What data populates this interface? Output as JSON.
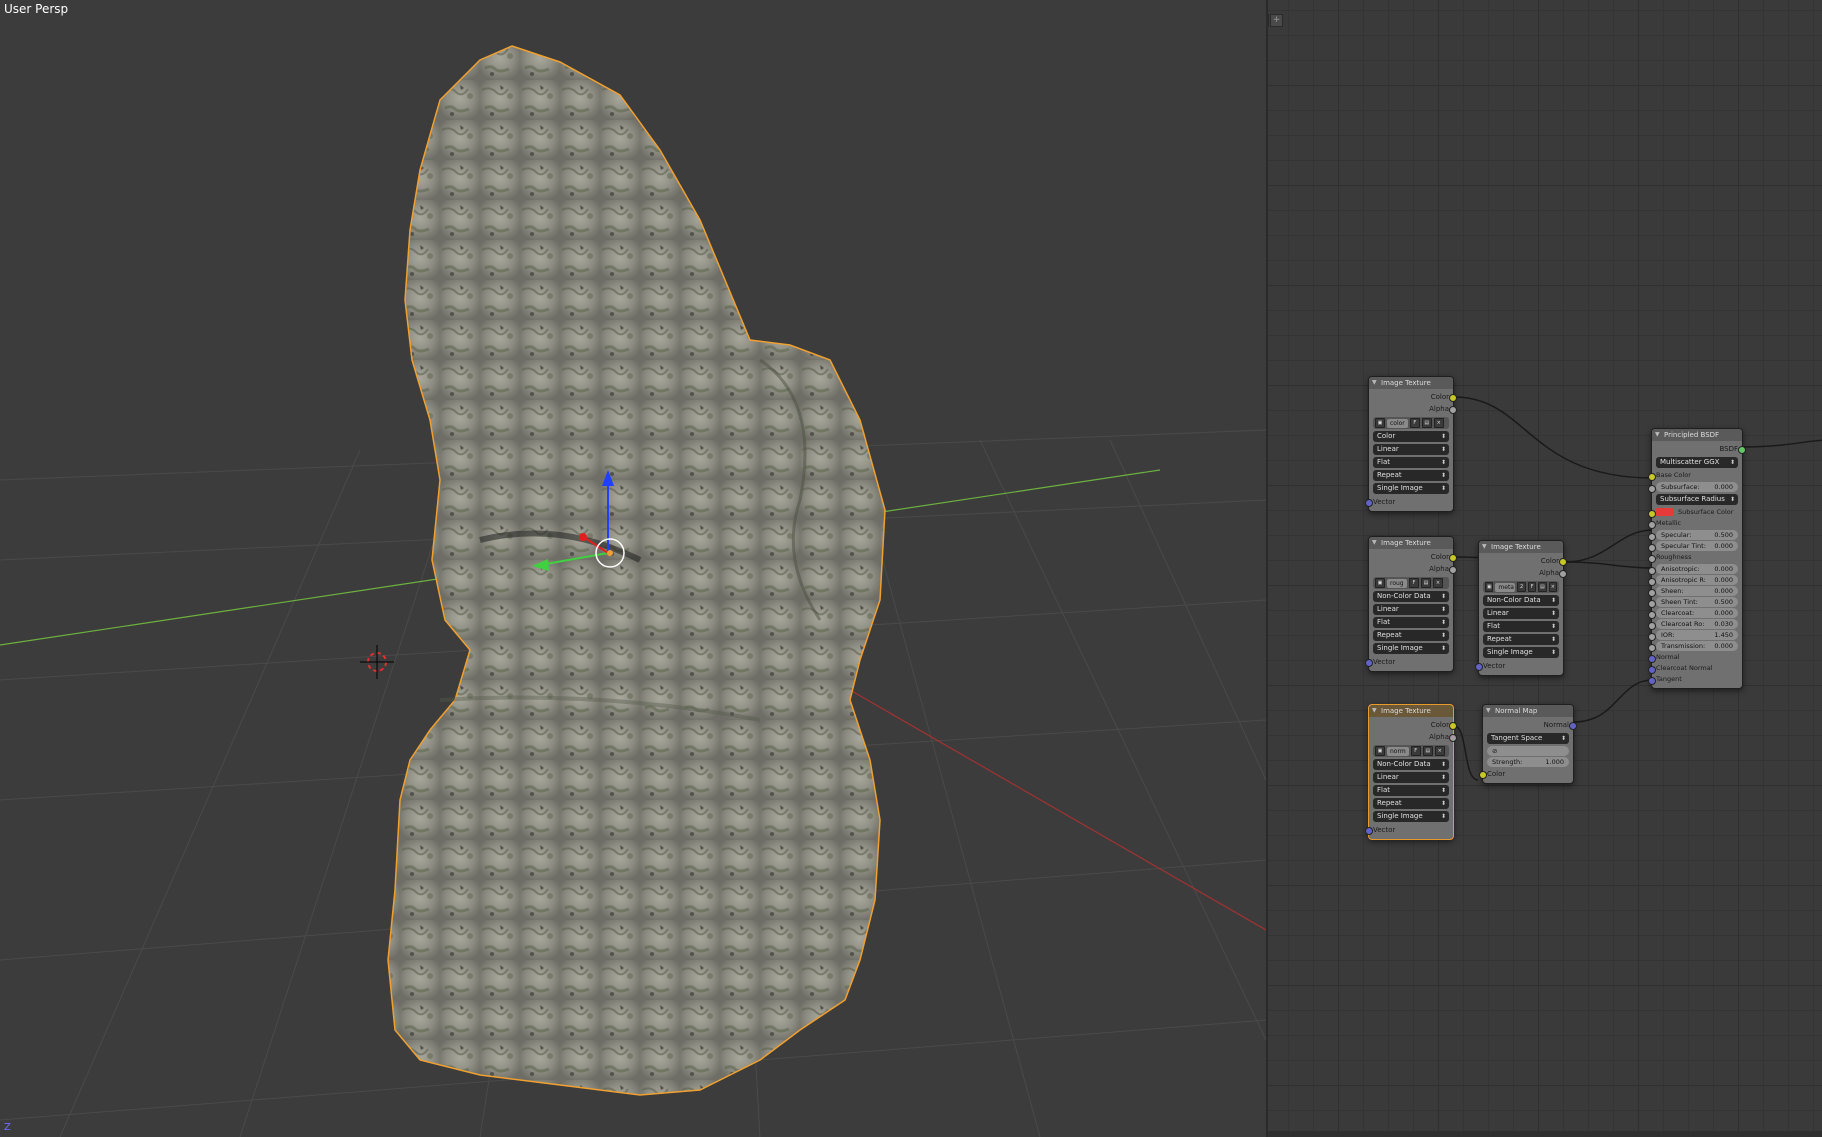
{
  "viewport": {
    "label": "User Persp",
    "axis_indicator": "Z"
  },
  "node_editor": {
    "corner_buttons": [
      "+",
      "+"
    ],
    "nodes": {
      "img1": {
        "title": "Image Texture",
        "out_color": "Color",
        "out_alpha": "Alpha",
        "image_name": "color",
        "image_flag": "F",
        "color_space": "Color",
        "interpolation": "Linear",
        "projection": "Flat",
        "extension": "Repeat",
        "source": "Single Image",
        "in_vector": "Vector"
      },
      "img2": {
        "title": "Image Texture",
        "out_color": "Color",
        "out_alpha": "Alpha",
        "image_name": "roug",
        "image_flag": "F",
        "color_space": "Non-Color Data",
        "interpolation": "Linear",
        "projection": "Flat",
        "extension": "Repeat",
        "source": "Single Image",
        "in_vector": "Vector"
      },
      "img3": {
        "title": "Image Texture",
        "out_color": "Color",
        "out_alpha": "Alpha",
        "image_name": "meta",
        "image_count": "2",
        "image_flag": "F",
        "color_space": "Non-Color Data",
        "interpolation": "Linear",
        "projection": "Flat",
        "extension": "Repeat",
        "source": "Single Image",
        "in_vector": "Vector"
      },
      "img4": {
        "title": "Image Texture",
        "out_color": "Color",
        "out_alpha": "Alpha",
        "image_name": "norm",
        "image_flag": "F",
        "color_space": "Non-Color Data",
        "interpolation": "Linear",
        "projection": "Flat",
        "extension": "Repeat",
        "source": "Single Image",
        "in_vector": "Vector"
      },
      "normalmap": {
        "title": "Normal Map",
        "out_normal": "Normal",
        "space": "Tangent Space",
        "uv_field": "",
        "strength_label": "Strength:",
        "strength_value": "1.000",
        "in_color": "Color"
      },
      "bsdf": {
        "title": "Principled BSDF",
        "out_bsdf": "BSDF",
        "distribution": "Multiscatter GGX",
        "base_color": "Base Color",
        "subsurface_label": "Subsurface:",
        "subsurface_value": "0.000",
        "subsurface_radius": "Subsurface Radius",
        "subsurface_color": "Subsurface Color",
        "metallic": "Metallic",
        "specular_label": "Specular:",
        "specular_value": "0.500",
        "specular_tint_label": "Specular Tint:",
        "specular_tint_value": "0.000",
        "roughness": "Roughness",
        "anisotropic_label": "Anisotropic:",
        "anisotropic_value": "0.000",
        "anisotropic_r_label": "Anisotropic R:",
        "anisotropic_r_value": "0.000",
        "sheen_label": "Sheen:",
        "sheen_value": "0.000",
        "sheen_tint_label": "Sheen Tint:",
        "sheen_tint_value": "0.500",
        "clearcoat_label": "Clearcoat:",
        "clearcoat_value": "0.000",
        "clearcoat_ro_label": "Clearcoat Ro:",
        "clearcoat_ro_value": "0.030",
        "ior_label": "IOR:",
        "ior_value": "1.450",
        "transmission_label": "Transmission:",
        "transmission_value": "0.000",
        "normal": "Normal",
        "clearcoat_normal": "Clearcoat Normal",
        "tangent": "Tangent"
      }
    }
  },
  "colors": {
    "viewport_bg": "#3c3c3c",
    "selection_outline": "#f0a030",
    "x_axis": "#b03030",
    "y_axis": "#70c040",
    "gizmo_z": "#2040ff",
    "subsurface_color": "#e63a3a"
  }
}
